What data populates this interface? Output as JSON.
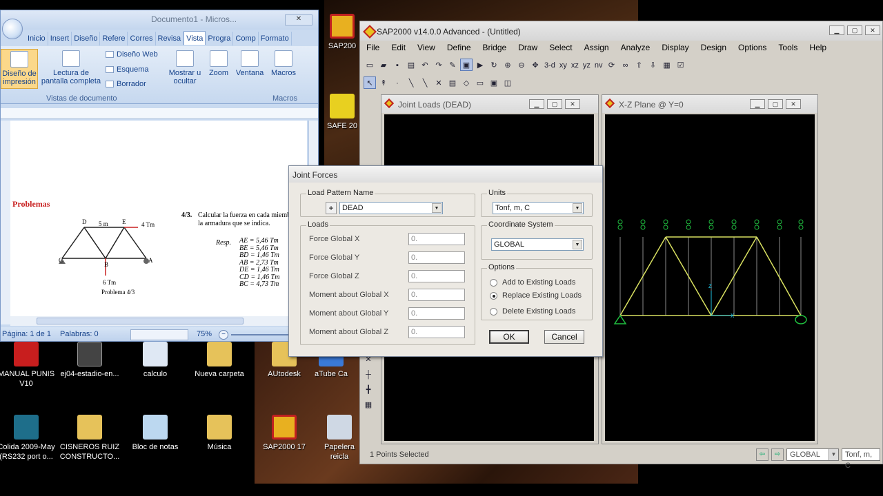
{
  "desktop": {
    "icons": [
      {
        "label": "MANUAL PUNIS V10"
      },
      {
        "label": "ej04-estadio-en..."
      },
      {
        "label": "calculo"
      },
      {
        "label": "Nueva carpeta"
      },
      {
        "label": "AUtodesk"
      },
      {
        "label": "aTube Ca"
      },
      {
        "label": "Colida 2009-May (RS232 port o..."
      },
      {
        "label": "CISNEROS RUIZ CONSTRUCTO..."
      },
      {
        "label": "Bloc de notas"
      },
      {
        "label": "Música"
      },
      {
        "label": "SAP2000 17"
      },
      {
        "label": "Papelera reicla"
      },
      {
        "label": "SAP200"
      },
      {
        "label": "SAFE 20"
      }
    ]
  },
  "word": {
    "title": "Documento1 - Micros...",
    "tabs": [
      "Inicio",
      "Insert",
      "Diseño",
      "Refere",
      "Corres",
      "Revisa",
      "Vista",
      "Progra",
      "Comp",
      "Formato"
    ],
    "ribbon": {
      "print_layout": "Diseño de impresión",
      "full_screen": "Lectura de pantalla completa",
      "web_layout": "Diseño Web",
      "outline": "Esquema",
      "draft": "Borrador",
      "show_hide": "Mostrar u ocultar",
      "zoom": "Zoom",
      "window": "Ventana",
      "macros": "Macros",
      "group_views": "Vistas de documento",
      "group_macros": "Macros"
    },
    "doc": {
      "heading": "Problemas",
      "problem_number": "4/3.",
      "problem_text": "Calcular la fuerza en cada miembro de la armadura que se indica.",
      "resp_label": "Resp.",
      "answers": [
        "AE = 5,46 Tm",
        "BE = 5,46 Tm",
        "BD = 1,46 Tm",
        "AB = 2,73 Tm",
        "DE = 1,46 Tm",
        "CD = 1,46 Tm",
        "BC = 4,73 Tm"
      ],
      "caption": "Problema 4/3",
      "labels": {
        "D": "D",
        "E": "E",
        "C": "C",
        "B": "B",
        "A": "A",
        "load1": "4 Tm",
        "load2": "6 Tm",
        "dim": "5 m"
      }
    },
    "status": {
      "page": "Página: 1 de 1",
      "words": "Palabras: 0",
      "zoom": "75%"
    }
  },
  "sap": {
    "title": "SAP2000 v14.0.0 Advanced  - (Untitled)",
    "menu": [
      "File",
      "Edit",
      "View",
      "Define",
      "Bridge",
      "Draw",
      "Select",
      "Assign",
      "Analyze",
      "Display",
      "Design",
      "Options",
      "Tools",
      "Help"
    ],
    "toolbar_text": [
      "3-d",
      "xy",
      "xz",
      "yz",
      "nv"
    ],
    "window_left": {
      "title": "Joint Loads (DEAD)"
    },
    "window_right": {
      "title": "X-Z Plane @ Y=0"
    },
    "status": {
      "text": "1 Points Selected",
      "coord_system": "GLOBAL",
      "units": "Tonf, m, C"
    }
  },
  "dialog": {
    "title": "Joint Forces",
    "load_pattern": {
      "label": "Load Pattern Name",
      "plus": "+",
      "value": "DEAD"
    },
    "units": {
      "label": "Units",
      "value": "Tonf, m, C"
    },
    "loads": {
      "label": "Loads",
      "fields": [
        {
          "label": "Force Global X",
          "value": "0."
        },
        {
          "label": "Force Global Y",
          "value": "0."
        },
        {
          "label": "Force Global Z",
          "value": "0."
        },
        {
          "label": "Moment about Global X",
          "value": "0."
        },
        {
          "label": "Moment about Global Y",
          "value": "0."
        },
        {
          "label": "Moment about Global Z",
          "value": "0."
        }
      ]
    },
    "coord": {
      "label": "Coordinate System",
      "value": "GLOBAL"
    },
    "options": {
      "label": "Options",
      "items": [
        {
          "label": "Add to Existing Loads",
          "selected": false
        },
        {
          "label": "Replace Existing Loads",
          "selected": true
        },
        {
          "label": "Delete Existing Loads",
          "selected": false
        }
      ]
    },
    "ok": "OK",
    "cancel": "Cancel"
  },
  "colors": {
    "truss": "#d8e060",
    "support": "#20c040",
    "axis": "#20c0e0",
    "sap_bg": "#d4d0c8"
  }
}
